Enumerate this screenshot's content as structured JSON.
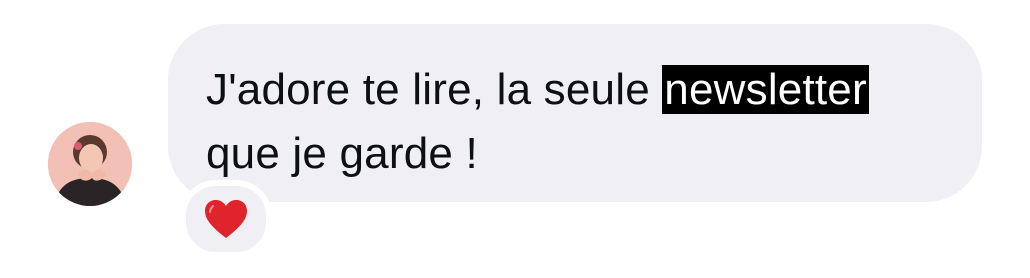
{
  "message": {
    "text_before": "J'adore te lire, la seule ",
    "highlighted": "newsletter",
    "text_after": " que je garde !"
  },
  "reaction": {
    "icon": "heart-icon",
    "color": "#e0242b"
  },
  "colors": {
    "bubble_bg": "#efeff4",
    "text": "#0c0f14",
    "highlight_bg": "#000000",
    "highlight_text": "#ffffff"
  }
}
